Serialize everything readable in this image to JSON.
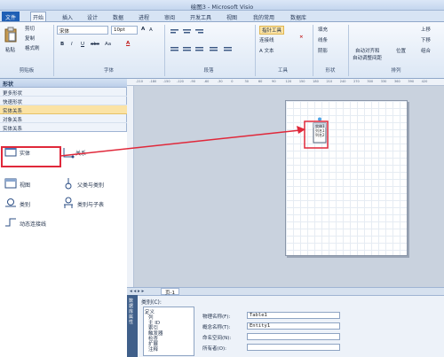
{
  "window": {
    "title": "绘图3 - Microsoft Visio"
  },
  "tabs": [
    {
      "label": "文件"
    },
    {
      "label": "开始"
    },
    {
      "label": "插入"
    },
    {
      "label": "设计"
    },
    {
      "label": "数据"
    },
    {
      "label": "进程"
    },
    {
      "label": "审阅"
    },
    {
      "label": "开发工具"
    },
    {
      "label": "视图"
    },
    {
      "label": "我的常用"
    },
    {
      "label": "数据库"
    }
  ],
  "ribbon": {
    "paste": "粘贴",
    "cut": "剪切",
    "copy": "复制",
    "format_painter": "格式刷",
    "clipboard_group": "剪贴板",
    "font_name": "宋体",
    "font_size": "10pt",
    "bold": "B",
    "italic": "I",
    "underline": "U",
    "strike": "abc",
    "case": "Aa",
    "font_color": "A",
    "font_group": "字体",
    "paragraph_group": "段落",
    "pointer_tool": "指针工具",
    "connector": "连接线",
    "text": "A 文本",
    "tools_group": "工具",
    "fill": "填充",
    "line": "线条",
    "shadow": "阴影",
    "shape_group": "形状",
    "auto_align": "自动对齐和",
    "auto_space": "自动调整间距",
    "position": "位置",
    "bring_forward": "上移",
    "send_backward": "下移",
    "group": "组合",
    "arrange_group": "排列"
  },
  "shapes_panel": {
    "header": "形状",
    "rows": [
      "更多形状",
      "快速形状",
      "实体关系",
      "对象关系",
      "实体关系"
    ],
    "items": [
      "实体",
      "关系",
      "视图",
      "父类与类别",
      "类别",
      "类别与子表",
      "动态连接线"
    ]
  },
  "ruler_ticks": [
    "-210",
    "-180",
    "-150",
    "-120",
    "-90",
    "-60",
    "-30",
    "0",
    "30",
    "60",
    "90",
    "120",
    "150",
    "180",
    "210",
    "240",
    "270",
    "300",
    "330",
    "360",
    "390",
    "420"
  ],
  "page_shape": {
    "label_lines": [
      "实体1",
      "列名1",
      "列名2"
    ]
  },
  "page_tab": "页-1",
  "props": {
    "header": "类别(C):",
    "side_label": "数据库属性",
    "categories": [
      "定义",
      "列",
      "主 ID",
      "索引",
      "触发器",
      "检查",
      "扩展",
      "注释"
    ],
    "physical_name_label": "物理名称(F):",
    "physical_name_value": "Table1",
    "conceptual_name_label": "概念名称(T):",
    "conceptual_name_value": "Entity1",
    "namespace_label": "命名空间(N):",
    "owner_label": "所有者(O):"
  },
  "colors": {
    "highlight": "#e0283a",
    "selected_row": "#fbe3a5",
    "accent": "#1f5fb5"
  }
}
